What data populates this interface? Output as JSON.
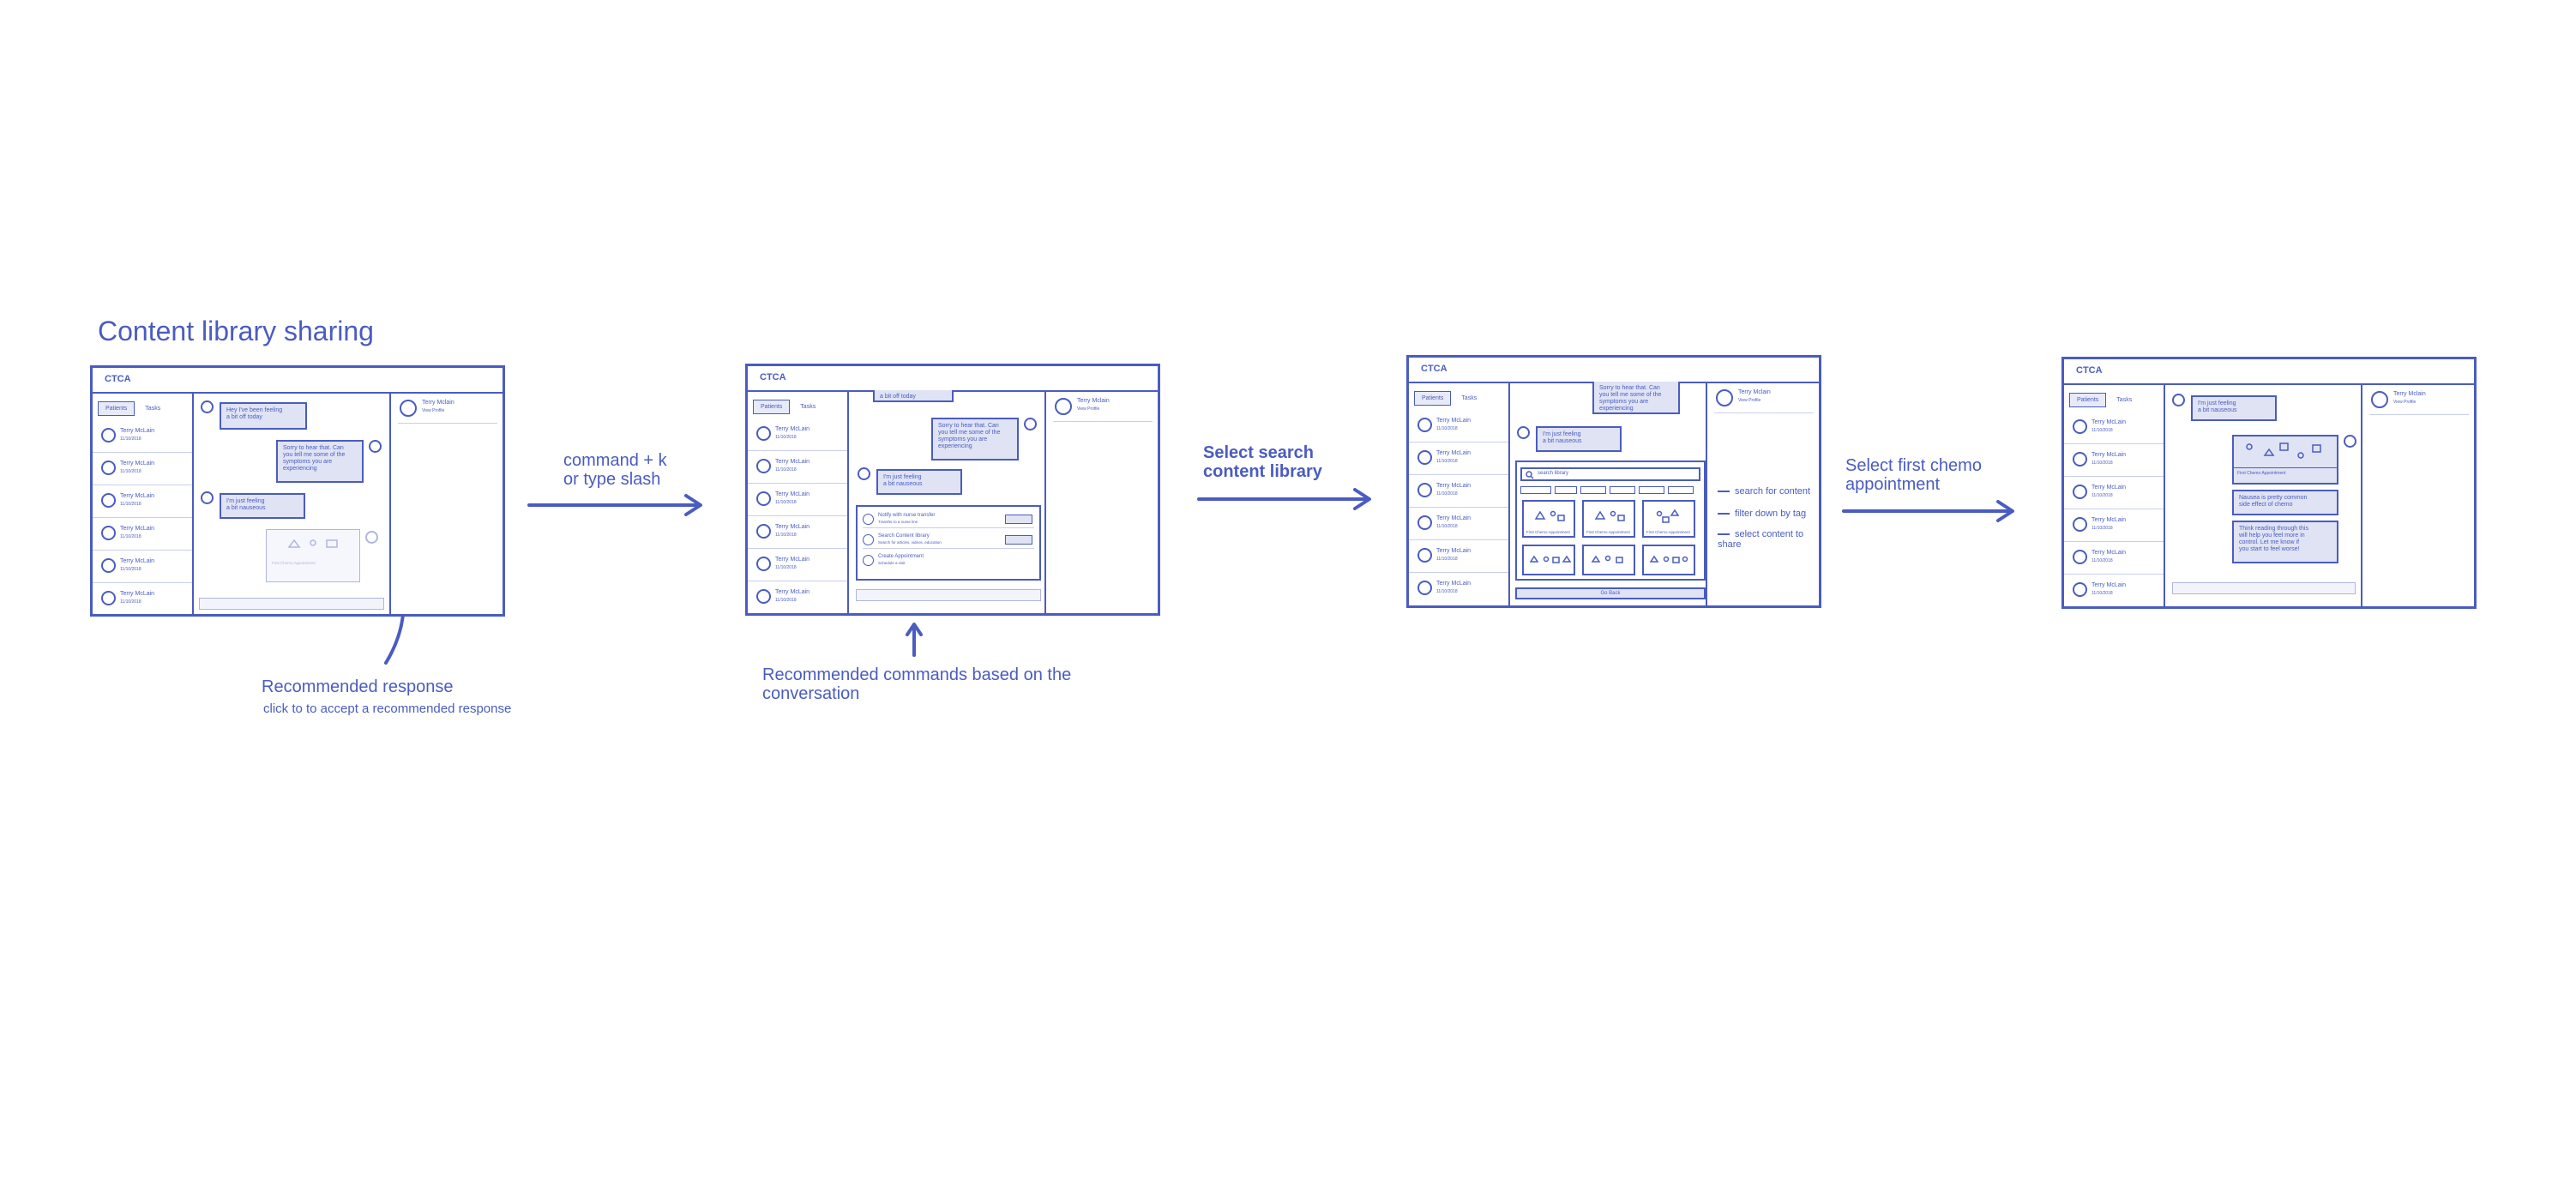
{
  "title": "Content library sharing",
  "brand": "CTCA",
  "tabs": {
    "patients": "Patients",
    "tasks": "Tasks"
  },
  "contact": {
    "name": "Terry McLain",
    "date": "11/10/2018"
  },
  "profile": {
    "name": "Terry Mclain",
    "sub": "View Profile"
  },
  "steps": {
    "step1": {
      "label": "command + k\nor type slash"
    },
    "step2": {
      "label": "Select search\ncontent library"
    },
    "step3": {
      "label": "Select first chemo\nappointment"
    }
  },
  "annotations": {
    "recommended_response": "Recommended response",
    "recommended_response_hint": "click to to accept a recommended response",
    "recommended_commands": "Recommended commands based on the\nconversation",
    "search_for_content": "search for content",
    "filter_by_tag": "filter down by tag",
    "select_content": "select content to\nshare"
  },
  "messages": {
    "m1": "Hey I've been feeling\na bit off today",
    "m1b": "a bit off today",
    "m2": "Sorry to hear that. Can\nyou tell me some of the\nsymptoms you are\nexperiencing",
    "m3": "I'm just feeling\na bit nauseous",
    "m4": "Nausea is pretty common\nside effect of chemo",
    "m5": "Think reading through this\nwill help you feel more in\ncontrol. Let me know if\nyou start to feel worse!"
  },
  "commands": [
    {
      "title": "Notify with nurse transfer",
      "sub": "Transfer to a nurse line"
    },
    {
      "title": "Search Content library",
      "sub": "Search for articles, videos, education"
    },
    {
      "title": "Create Appointment",
      "sub": "Schedule a visit"
    }
  ],
  "library": {
    "search_placeholder": "search library",
    "card_caption": "First Chemo Appointment",
    "go_back": "Go Back"
  },
  "colors": {
    "ink": "#4a5cc0",
    "bubble": "#dfe3f4"
  }
}
